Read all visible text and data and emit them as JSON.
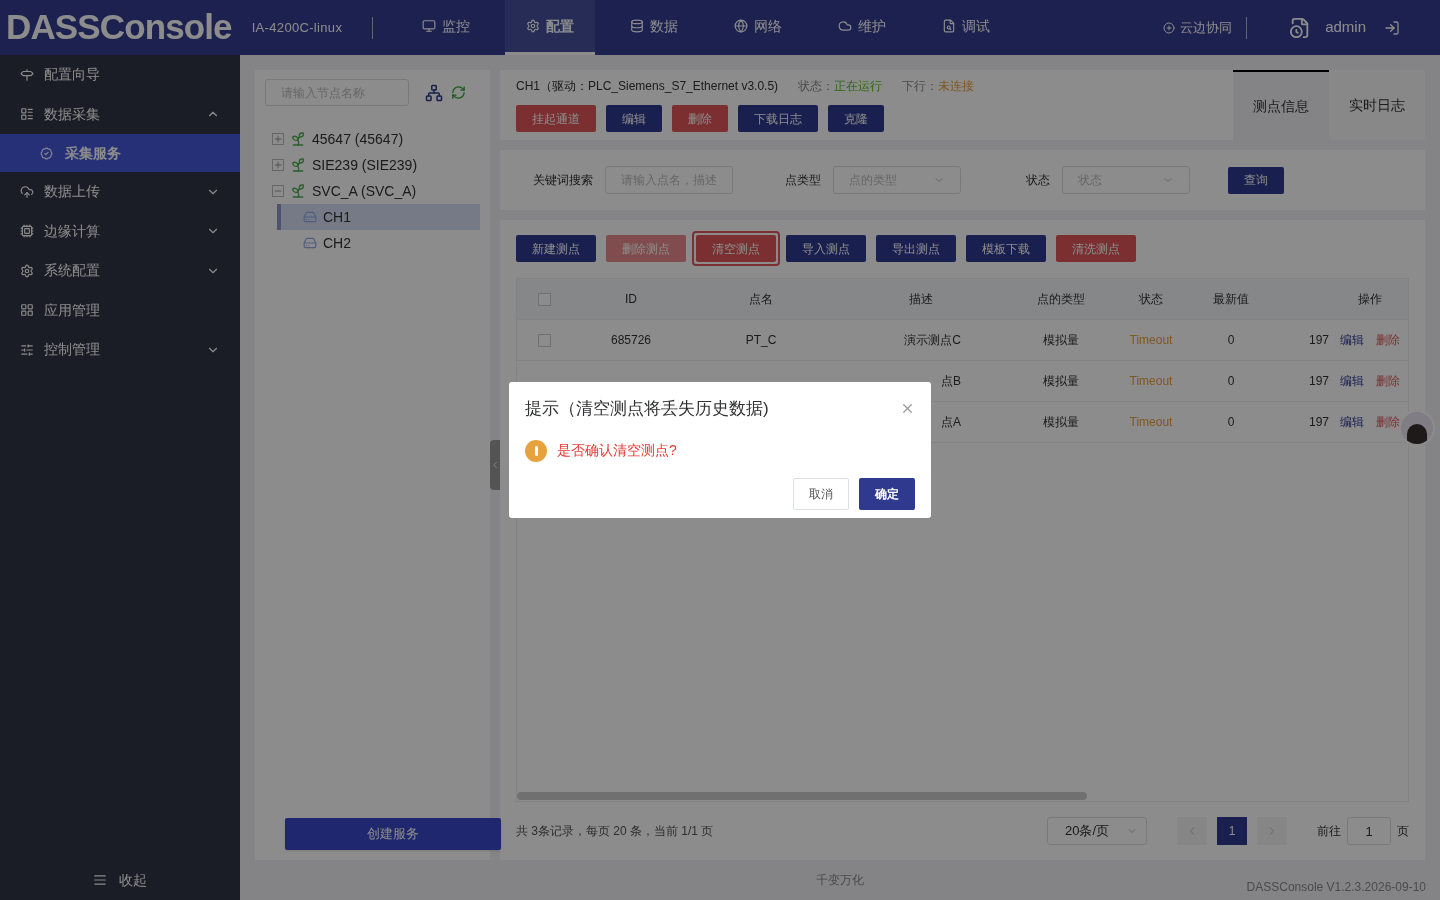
{
  "header": {
    "logo": "DASSConsole",
    "device": "IA-4200C-linux",
    "nav": [
      {
        "label": "监控",
        "selected": false
      },
      {
        "label": "配置",
        "selected": true
      },
      {
        "label": "数据",
        "selected": false
      },
      {
        "label": "网络",
        "selected": false
      },
      {
        "label": "维护",
        "selected": false
      },
      {
        "label": "调试",
        "selected": false
      }
    ],
    "cloud": "云边协同",
    "user": "admin"
  },
  "sidebar": {
    "items": [
      {
        "label": "配置向导"
      },
      {
        "label": "数据采集",
        "expanded": true,
        "children": [
          {
            "label": "采集服务",
            "selected": true
          }
        ]
      },
      {
        "label": "数据上传",
        "expanded": false
      },
      {
        "label": "边缘计算",
        "expanded": false
      },
      {
        "label": "系统配置",
        "expanded": false
      },
      {
        "label": "应用管理"
      },
      {
        "label": "控制管理",
        "expanded": false
      }
    ],
    "collapse": "收起"
  },
  "tree": {
    "search_placeholder": "请输入节点名称",
    "nodes": [
      {
        "label": "45647 (45647)",
        "expanded": false
      },
      {
        "label": "SIE239 (SIE239)",
        "expanded": false
      },
      {
        "label": "SVC_A (SVC_A)",
        "expanded": true,
        "children": [
          {
            "label": "CH1",
            "selected": true
          },
          {
            "label": "CH2",
            "selected": false
          }
        ]
      }
    ],
    "create_button": "创建服务"
  },
  "channel": {
    "title": "CH1（驱动：PLC_Siemens_S7_Ethernet v3.0.5)",
    "status_label": "状态：",
    "status": "正在运行",
    "downlink_label": "下行：",
    "downlink": "未连接",
    "buttons": [
      {
        "label": "挂起通道",
        "kind": "danger"
      },
      {
        "label": "编辑",
        "kind": "primary"
      },
      {
        "label": "删除",
        "kind": "danger"
      },
      {
        "label": "下载日志",
        "kind": "primary"
      },
      {
        "label": "克隆",
        "kind": "primary"
      }
    ],
    "tabs": [
      {
        "label": "测点信息",
        "selected": true
      },
      {
        "label": "实时日志",
        "selected": false
      }
    ]
  },
  "filters": {
    "keyword_label": "关键词搜索",
    "keyword_placeholder": "请输入点名，描述",
    "type_label": "点类型",
    "type_placeholder": "点的类型",
    "status_label": "状态",
    "status_placeholder": "状态",
    "query": "查询"
  },
  "toolbar": [
    {
      "label": "新建测点",
      "kind": "primary",
      "disabled": false,
      "focused": false
    },
    {
      "label": "删除测点",
      "kind": "danger",
      "disabled": true,
      "focused": false
    },
    {
      "label": "清空测点",
      "kind": "danger",
      "disabled": false,
      "focused": true
    },
    {
      "label": "导入测点",
      "kind": "primary",
      "disabled": false,
      "focused": false
    },
    {
      "label": "导出测点",
      "kind": "primary",
      "disabled": false,
      "focused": false
    },
    {
      "label": "模板下载",
      "kind": "primary",
      "disabled": false,
      "focused": false
    },
    {
      "label": "清洗测点",
      "kind": "danger",
      "disabled": false,
      "focused": false
    }
  ],
  "table": {
    "select_all_checked": false,
    "columns": [
      "ID",
      "点名",
      "描述",
      "点的类型",
      "状态",
      "最新值",
      "操作"
    ],
    "rows": [
      {
        "checked": false,
        "id": "685726",
        "name": "PT_C",
        "description": "演示测点C",
        "type": "模拟量",
        "status": "Timeout",
        "value": "0",
        "column_8": "197",
        "edit": "编辑",
        "delete": "删除"
      },
      {
        "description": "点B",
        "type": "模拟量",
        "status": "Timeout",
        "value": "0",
        "column_8": "197",
        "edit": "编辑",
        "delete": "删除"
      },
      {
        "description": "点A",
        "type": "模拟量",
        "status": "Timeout",
        "value": "0",
        "column_8": "197",
        "edit": "编辑",
        "delete": "删除"
      }
    ]
  },
  "pagination": {
    "summary": "共 3条记录，每页 20 条，当前 1/1 页",
    "page_size": "20条/页",
    "pages": [
      {
        "label": "1",
        "selected": true
      }
    ],
    "goto_label": "前往",
    "goto_value": "1",
    "page_suffix": "页"
  },
  "footer": {
    "center": "千变万化",
    "version": "DASSConsole V1.2.3.2026-09-10"
  },
  "dialog": {
    "title": "提示（清空测点将丢失历史数据)",
    "message": "是否确认清空测点?",
    "cancel": "取消",
    "confirm": "确定"
  }
}
